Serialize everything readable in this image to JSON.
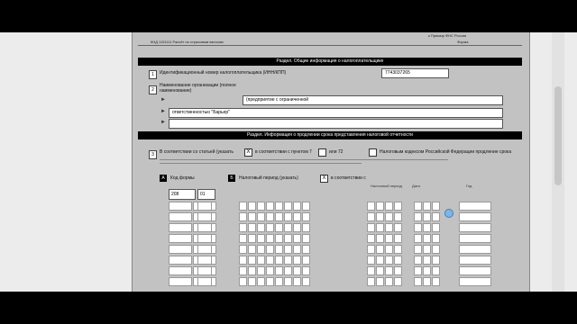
{
  "page": {
    "header_right_line1": "к Приказу ФНС России",
    "header_right_line2": "Форма",
    "top_note": "КНД 1151111 Расчёт по страховым взносам",
    "section1_title": "Раздел. Общие информация о налогоплательщике",
    "row1": {
      "num": "1",
      "label": "Идентификационный номер налогоплательщика (ИНН/КПП)",
      "value": "7743037265"
    },
    "row2": {
      "num": "2",
      "label": "Наименование организации (полное наименование)",
      "values": [
        "(предприятие с ограниченной",
        "ответственностью \"Барьер\"",
        "",
        ""
      ]
    },
    "section2_title": "Раздел. Информация о продлении срока представления налоговой отчетности",
    "row3": {
      "num": "3",
      "lead": "В соответствии со статьей (указать",
      "opt1_mark": "X",
      "opt1_label": "в соответствии с пунктом 7",
      "opt2_label": "или 72",
      "tail": "Налоговым кодексом Российской Федерации продление срока"
    },
    "blockA": {
      "letter": "A",
      "label": "Код формы",
      "code1": "208",
      "code2": "01"
    },
    "blockB": {
      "letter": "Б",
      "label": "Налоговый период (указать)",
      "mark": "X",
      "label2": "в соответствии с"
    },
    "col_headers": [
      "Налоговый период",
      "Дата",
      "Год"
    ]
  }
}
